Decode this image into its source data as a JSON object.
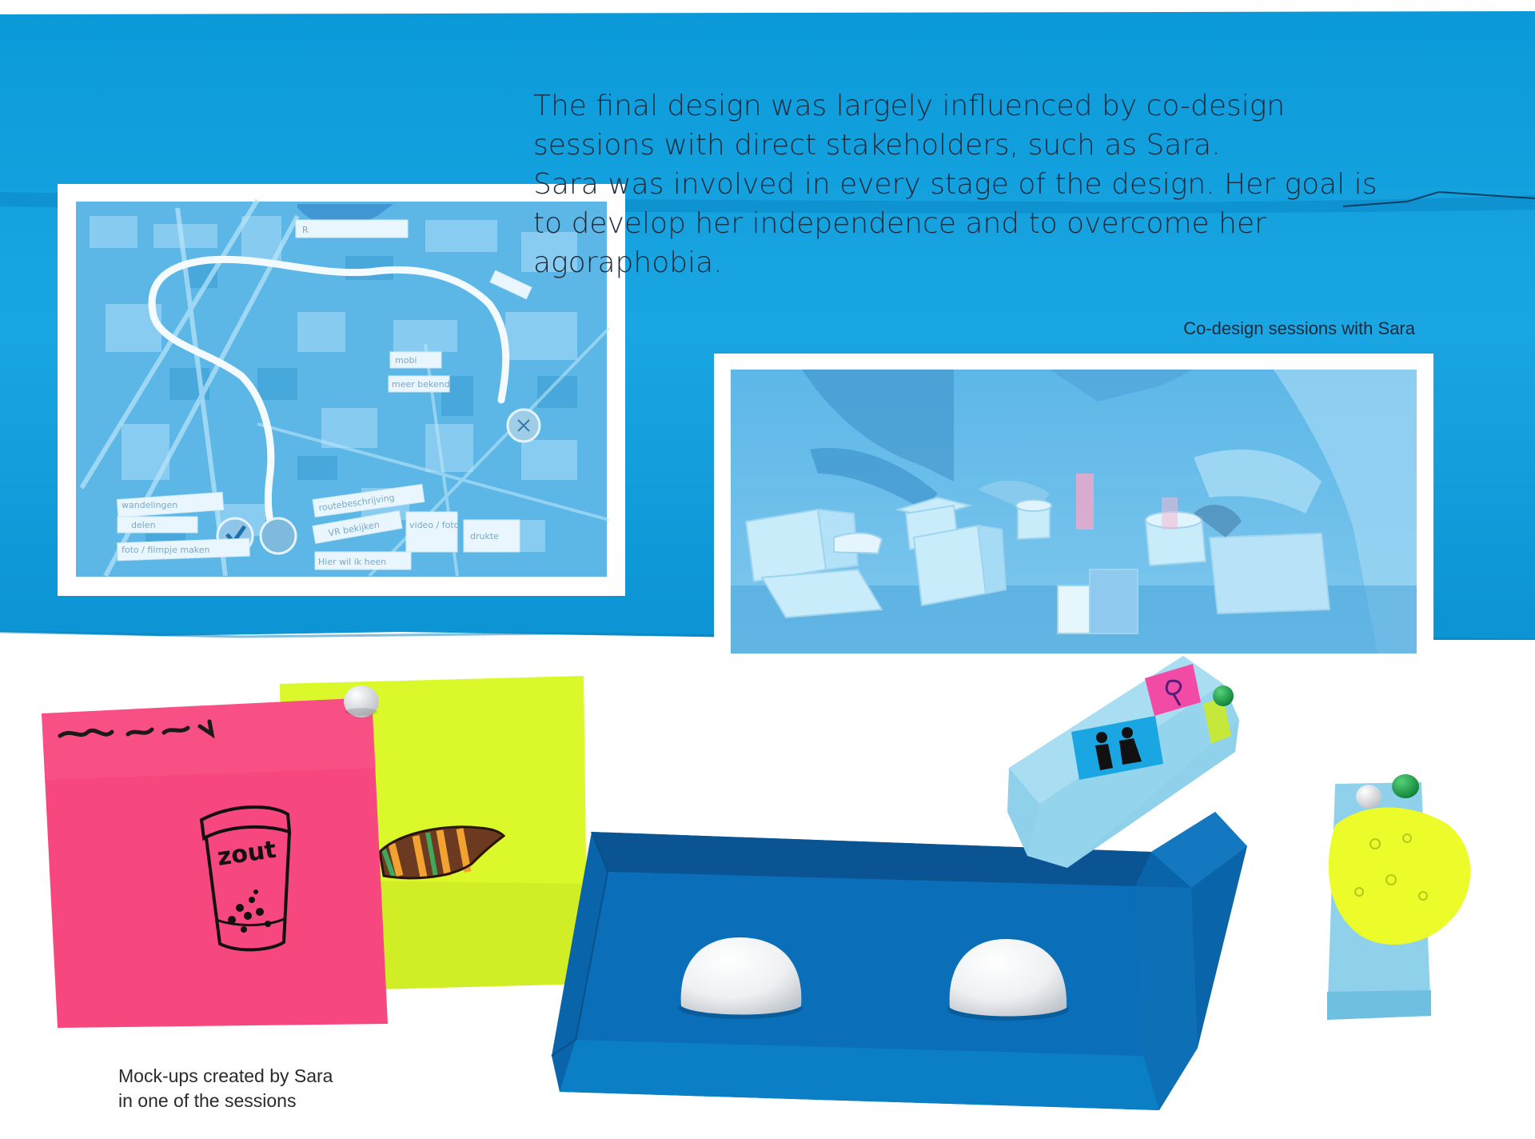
{
  "intro": {
    "text": "The final design was largely influenced by co-design\nsessions with direct stakeholders, such as Sara.\nSara was involved in every stage of the design. Her goal is\nto develop her independence and to overcome her\nagoraphobia."
  },
  "captions": {
    "sessions": "Co-design sessions with Sara",
    "mockups": "Mock-ups created by Sara\nin one of the sessions"
  },
  "map_labels": {
    "top": "R",
    "right_1": "mobi",
    "right_2": "meer bekend",
    "bottom_1": "wandelingen",
    "bottom_2": "delen",
    "bottom_3": "foto / filmpje maken",
    "bottom_4": "routebeschrijving",
    "bottom_5": "VR bekijken",
    "bottom_6": "video / foto",
    "bottom_7": "drukte",
    "bottom_8": "Hier wil ik heen"
  },
  "mockup_text": {
    "salt_jar": "zout"
  },
  "colors": {
    "board_blue": "#0a97d7",
    "text_dark": "#1d2a3c",
    "sticky_pink": "#f7477f",
    "sticky_yellow": "#dbf82a",
    "tray_blue": "#0a64aa"
  }
}
